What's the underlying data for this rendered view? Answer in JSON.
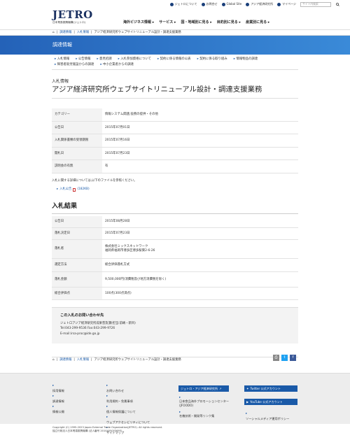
{
  "topbar": {
    "items": [
      "ジェトロについて",
      "お問合せ",
      "Global Site",
      "アジア経済研究所"
    ],
    "mypage": "マイページ",
    "search_placeholder": "サイト内検索"
  },
  "logo": {
    "brand": "JETRO",
    "subtitle": "日本貿易振興機構(ジェトロ)"
  },
  "gnav": [
    "海外ビジネス情報 ▸",
    "サービス ▸",
    "国・地域別に見る ▸",
    "目的別に見る ▸",
    "産業別に見る ▸"
  ],
  "breadcrumb": {
    "home": "⌂",
    "items": [
      "調達情報",
      "入札情報"
    ],
    "current": "アジア経済研究所ウェブサイトリニューアル設計・調達支援業務"
  },
  "banner": "調達情報",
  "subnav": [
    "入札情報",
    "公告情報",
    "意見招請",
    "入札参加資格について",
    "契約に係る情報の公表",
    "契約に係る取り組み",
    "情報物品の調達",
    "障害者就労施設からの調達",
    "中小企業者からの調達"
  ],
  "pre_title": "入札情報",
  "title": "アジア経済研究所ウェブサイトリニューアル設計・調達支援業務",
  "info_table": [
    {
      "k": "カテゴリー",
      "v": "情報システム関連,役務の提供・その他"
    },
    {
      "k": "公告日",
      "v": "2015年07月01日"
    },
    {
      "k": "入札関係書類の受領期限",
      "v": "2015年07月16日"
    },
    {
      "k": "開札日",
      "v": "2015年07月23日"
    },
    {
      "k": "説明会の有無",
      "v": "有"
    }
  ],
  "note": "入札に関する詳細については,以下のファイルを参照ください。",
  "pdf_link": "入札公告",
  "pdf_size": "(182KB)",
  "result_heading": "入札結果",
  "result_table": [
    {
      "k": "公告日",
      "v": "2015年08月28日"
    },
    {
      "k": "落札決定日",
      "v": "2015年07月23日"
    },
    {
      "k": "落札者",
      "v": "株式会社ミックスネットワーク",
      "v2": "福岡県福岡市博多区博多駅東2-6-26"
    },
    {
      "k": "選定方法",
      "v": "総合評価落札方式"
    },
    {
      "k": "落札金額",
      "v": "9,500,000円(消費税及び地方消費税を除く)"
    },
    {
      "k": "総合評価点",
      "v": "100点(300点満点)"
    }
  ],
  "contact": {
    "title": "この入札のお問い合わせ先",
    "lines": [
      "ジェトロアジア経済研究所成果普及課(担当:前嶋・新目)",
      "Tel:043-299-9536 Fax:043-299-9726",
      "E-mail:irsa-proc@ide.go.jp"
    ]
  },
  "footer": {
    "col1": [
      "採用情報",
      "調達情報",
      "情報公開"
    ],
    "col2": [
      "お問い合わせ",
      "利用規約・免責事項",
      "個人情報保護について",
      "ウェブアクセシビリティについて",
      "サイトマップ"
    ],
    "jetro_btn": "ジェトロ・アジア経済研究所",
    "col3": [
      "日本食品海外プロモーションセンター(JFOODO)",
      "名機技術・開発等リンク集"
    ],
    "twitter": "Twitter 公式アカウント",
    "youtube": "YouTube 公式アカウント",
    "social": "ソーシャルメディア運用ポリシー",
    "copyright": "Copyright (C) 1995-2023 Japan External Trade Organization(JETRO). All rights reserved.",
    "corp": "独立行政法人日本貿易振興機構 (法人番号 2010405003693)"
  },
  "colors": {
    "accent": "#1a5aa8",
    "banner": "#2e78cc",
    "facebook": "#3b5998",
    "twitter": "#1da1f2",
    "print": "#888888"
  }
}
